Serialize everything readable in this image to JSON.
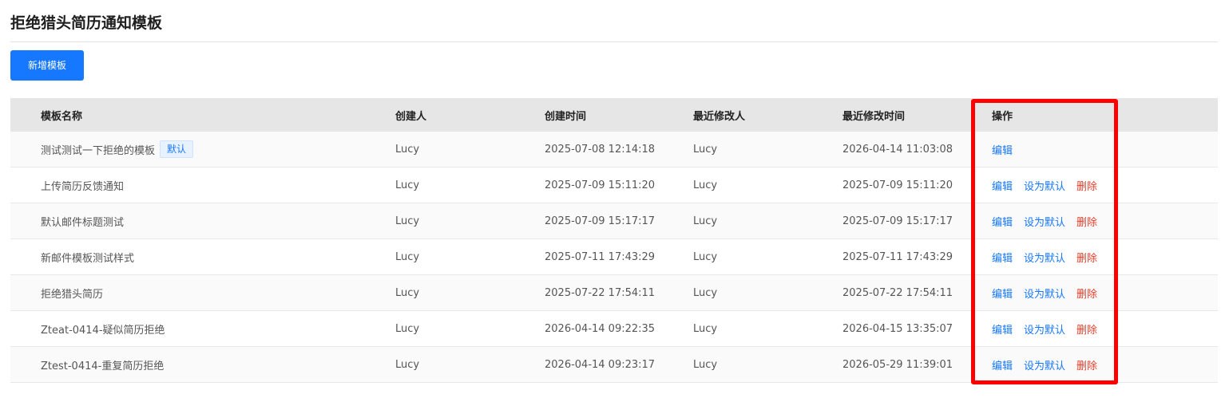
{
  "page": {
    "title": "拒绝猎头简历通知模板",
    "add_button_label": "新增模板"
  },
  "table": {
    "columns": [
      "模板名称",
      "创建人",
      "创建时间",
      "最近修改人",
      "最近修改时间",
      "操作"
    ],
    "rows": [
      {
        "name": "测试测试一下拒绝的模板",
        "badge": "默认",
        "creator": "Lucy",
        "created_at": "2025-07-08 12:14:18",
        "modifier": "Lucy",
        "modified_at": "2026-04-14 11:03:08",
        "ops": {
          "edit": "编辑"
        }
      },
      {
        "name": "上传简历反馈通知",
        "creator": "Lucy",
        "created_at": "2025-07-09 15:11:20",
        "modifier": "Lucy",
        "modified_at": "2025-07-09 15:11:20",
        "ops": {
          "edit": "编辑",
          "set_default": "设为默认",
          "delete": "删除"
        }
      },
      {
        "name": "默认邮件标题测试",
        "creator": "Lucy",
        "created_at": "2025-07-09 15:17:17",
        "modifier": "Lucy",
        "modified_at": "2025-07-09 15:17:17",
        "ops": {
          "edit": "编辑",
          "set_default": "设为默认",
          "delete": "删除"
        }
      },
      {
        "name": "新邮件模板测试样式",
        "creator": "Lucy",
        "created_at": "2025-07-11 17:43:29",
        "modifier": "Lucy",
        "modified_at": "2025-07-11 17:43:29",
        "ops": {
          "edit": "编辑",
          "set_default": "设为默认",
          "delete": "删除"
        }
      },
      {
        "name": "拒绝猎头简历",
        "creator": "Lucy",
        "created_at": "2025-07-22 17:54:11",
        "modifier": "Lucy",
        "modified_at": "2025-07-22 17:54:11",
        "ops": {
          "edit": "编辑",
          "set_default": "设为默认",
          "delete": "删除"
        }
      },
      {
        "name": "Zteat-0414-疑似简历拒绝",
        "creator": "Lucy",
        "created_at": "2026-04-14 09:22:35",
        "modifier": "Lucy",
        "modified_at": "2026-04-15 13:35:07",
        "ops": {
          "edit": "编辑",
          "set_default": "设为默认",
          "delete": "删除"
        }
      },
      {
        "name": "Ztest-0414-重复简历拒绝",
        "creator": "Lucy",
        "created_at": "2026-04-14 09:23:17",
        "modifier": "Lucy",
        "modified_at": "2026-05-29 11:39:01",
        "ops": {
          "edit": "编辑",
          "set_default": "设为默认",
          "delete": "删除"
        }
      }
    ]
  },
  "colors": {
    "primary": "#1677ff",
    "danger": "#e8402d",
    "header_bg": "#e6e6e6",
    "highlight": "#ff0000"
  }
}
